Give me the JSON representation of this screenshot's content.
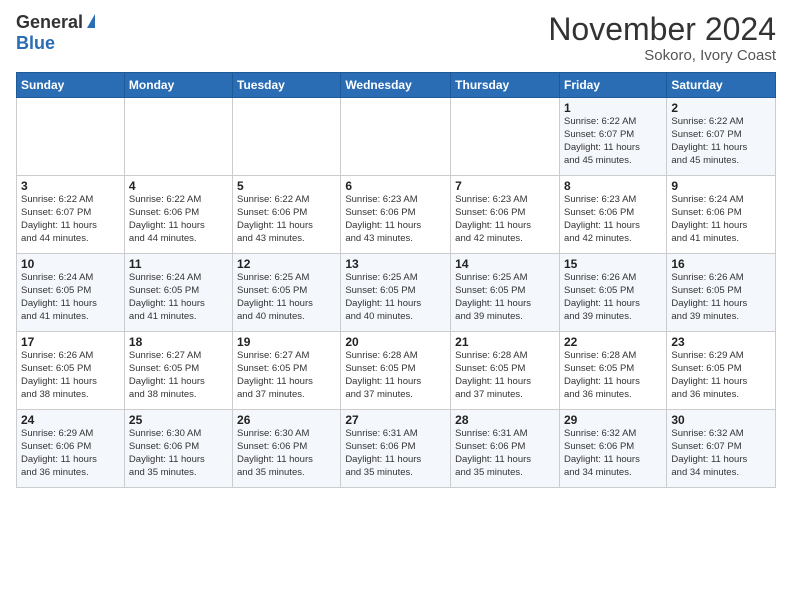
{
  "header": {
    "logo_general": "General",
    "logo_blue": "Blue",
    "month_title": "November 2024",
    "location": "Sokoro, Ivory Coast"
  },
  "weekdays": [
    "Sunday",
    "Monday",
    "Tuesday",
    "Wednesday",
    "Thursday",
    "Friday",
    "Saturday"
  ],
  "weeks": [
    [
      {
        "day": "",
        "info": ""
      },
      {
        "day": "",
        "info": ""
      },
      {
        "day": "",
        "info": ""
      },
      {
        "day": "",
        "info": ""
      },
      {
        "day": "",
        "info": ""
      },
      {
        "day": "1",
        "info": "Sunrise: 6:22 AM\nSunset: 6:07 PM\nDaylight: 11 hours\nand 45 minutes."
      },
      {
        "day": "2",
        "info": "Sunrise: 6:22 AM\nSunset: 6:07 PM\nDaylight: 11 hours\nand 45 minutes."
      }
    ],
    [
      {
        "day": "3",
        "info": "Sunrise: 6:22 AM\nSunset: 6:07 PM\nDaylight: 11 hours\nand 44 minutes."
      },
      {
        "day": "4",
        "info": "Sunrise: 6:22 AM\nSunset: 6:06 PM\nDaylight: 11 hours\nand 44 minutes."
      },
      {
        "day": "5",
        "info": "Sunrise: 6:22 AM\nSunset: 6:06 PM\nDaylight: 11 hours\nand 43 minutes."
      },
      {
        "day": "6",
        "info": "Sunrise: 6:23 AM\nSunset: 6:06 PM\nDaylight: 11 hours\nand 43 minutes."
      },
      {
        "day": "7",
        "info": "Sunrise: 6:23 AM\nSunset: 6:06 PM\nDaylight: 11 hours\nand 42 minutes."
      },
      {
        "day": "8",
        "info": "Sunrise: 6:23 AM\nSunset: 6:06 PM\nDaylight: 11 hours\nand 42 minutes."
      },
      {
        "day": "9",
        "info": "Sunrise: 6:24 AM\nSunset: 6:06 PM\nDaylight: 11 hours\nand 41 minutes."
      }
    ],
    [
      {
        "day": "10",
        "info": "Sunrise: 6:24 AM\nSunset: 6:05 PM\nDaylight: 11 hours\nand 41 minutes."
      },
      {
        "day": "11",
        "info": "Sunrise: 6:24 AM\nSunset: 6:05 PM\nDaylight: 11 hours\nand 41 minutes."
      },
      {
        "day": "12",
        "info": "Sunrise: 6:25 AM\nSunset: 6:05 PM\nDaylight: 11 hours\nand 40 minutes."
      },
      {
        "day": "13",
        "info": "Sunrise: 6:25 AM\nSunset: 6:05 PM\nDaylight: 11 hours\nand 40 minutes."
      },
      {
        "day": "14",
        "info": "Sunrise: 6:25 AM\nSunset: 6:05 PM\nDaylight: 11 hours\nand 39 minutes."
      },
      {
        "day": "15",
        "info": "Sunrise: 6:26 AM\nSunset: 6:05 PM\nDaylight: 11 hours\nand 39 minutes."
      },
      {
        "day": "16",
        "info": "Sunrise: 6:26 AM\nSunset: 6:05 PM\nDaylight: 11 hours\nand 39 minutes."
      }
    ],
    [
      {
        "day": "17",
        "info": "Sunrise: 6:26 AM\nSunset: 6:05 PM\nDaylight: 11 hours\nand 38 minutes."
      },
      {
        "day": "18",
        "info": "Sunrise: 6:27 AM\nSunset: 6:05 PM\nDaylight: 11 hours\nand 38 minutes."
      },
      {
        "day": "19",
        "info": "Sunrise: 6:27 AM\nSunset: 6:05 PM\nDaylight: 11 hours\nand 37 minutes."
      },
      {
        "day": "20",
        "info": "Sunrise: 6:28 AM\nSunset: 6:05 PM\nDaylight: 11 hours\nand 37 minutes."
      },
      {
        "day": "21",
        "info": "Sunrise: 6:28 AM\nSunset: 6:05 PM\nDaylight: 11 hours\nand 37 minutes."
      },
      {
        "day": "22",
        "info": "Sunrise: 6:28 AM\nSunset: 6:05 PM\nDaylight: 11 hours\nand 36 minutes."
      },
      {
        "day": "23",
        "info": "Sunrise: 6:29 AM\nSunset: 6:05 PM\nDaylight: 11 hours\nand 36 minutes."
      }
    ],
    [
      {
        "day": "24",
        "info": "Sunrise: 6:29 AM\nSunset: 6:06 PM\nDaylight: 11 hours\nand 36 minutes."
      },
      {
        "day": "25",
        "info": "Sunrise: 6:30 AM\nSunset: 6:06 PM\nDaylight: 11 hours\nand 35 minutes."
      },
      {
        "day": "26",
        "info": "Sunrise: 6:30 AM\nSunset: 6:06 PM\nDaylight: 11 hours\nand 35 minutes."
      },
      {
        "day": "27",
        "info": "Sunrise: 6:31 AM\nSunset: 6:06 PM\nDaylight: 11 hours\nand 35 minutes."
      },
      {
        "day": "28",
        "info": "Sunrise: 6:31 AM\nSunset: 6:06 PM\nDaylight: 11 hours\nand 35 minutes."
      },
      {
        "day": "29",
        "info": "Sunrise: 6:32 AM\nSunset: 6:06 PM\nDaylight: 11 hours\nand 34 minutes."
      },
      {
        "day": "30",
        "info": "Sunrise: 6:32 AM\nSunset: 6:07 PM\nDaylight: 11 hours\nand 34 minutes."
      }
    ]
  ]
}
